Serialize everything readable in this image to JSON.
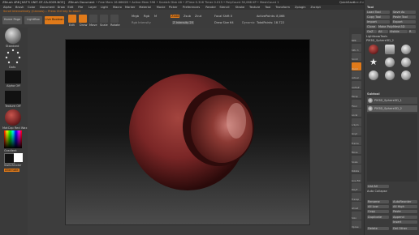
{
  "titlebar": {
    "app": "ZBrush 4R8 [HAT'S UNIT-OF-CA-0009-NO3]",
    "doc": "ZBrush Document",
    "mem": "• Free Mem 16.666GB • Active Mem 596 • Scratch Disk 48 • ZTime 0.316 Timer 0.013 • PolyCount 30,066 KP • MeshCount 1",
    "quicksave": "QuickSave",
    "seethrough": "See-through 0",
    "menus_label": "Menus",
    "default_zscript": "DefaultZScript"
  },
  "menubar": [
    "Alpha",
    "Brush",
    "Color",
    "Document",
    "Draw",
    "Edit",
    "File",
    "Layer",
    "Light",
    "Macro",
    "Marker",
    "Material",
    "Movie",
    "Picker",
    "Preferences",
    "Render",
    "Stencil",
    "Stroke",
    "Texture",
    "Tool",
    "Transform",
    "Zplugin",
    "Zscript"
  ],
  "hint": "Scroll interactively (Canvas)... Press Ctrl key to abort",
  "topshelf": {
    "home": "Home Page",
    "lightbox": "LightBox",
    "live_boolean": "Live Boolean",
    "edit": "Edit",
    "draw": "Draw",
    "move": "Move",
    "scale": "Scale",
    "rotate": "Rotate",
    "mrgb": "Mrgb",
    "rgb": "Rgb",
    "m": "M",
    "zadd": "Zadd",
    "zsub": "Zsub",
    "zcut": "Zcut",
    "zintensity": "Z Intensity 25",
    "focal_shift": "Focal Shift 0",
    "draw_size": "Draw Size 64",
    "dynamic": "Dynamic",
    "active_points": "ActivePoints: 8,066",
    "total_points": "TotalPoints: 18.722",
    "rgb_intensity": "Rgb Intensity"
  },
  "leftshelf": {
    "brush": "Standard",
    "stroke": "Dots",
    "alpha": "Alpha Off",
    "texture": "Texture Off",
    "material": "MatCap Red Wax",
    "gradient": "Gradient",
    "switch": "SwitchColor",
    "alternate": "Alternate"
  },
  "rightbar": [
    "BPR",
    "SPix 3",
    "Scroll",
    "Zoom",
    "Actual",
    "AAHalf",
    "Persp",
    "Floor",
    "Local",
    "L.Sym",
    "Gxyz",
    "Frame",
    "Move",
    "Scale",
    "Rotate",
    "Line Fill",
    "PolyF",
    "Transp",
    "Ghost",
    "Solo",
    "Xpose"
  ],
  "tool": {
    "header": "Tool",
    "load_tool": "Load Tool",
    "save_as": "Save As",
    "copy_tool": "Copy Tool",
    "paste_tool": "Paste Tool",
    "import": "Import",
    "export": "Export",
    "clone": "Clone",
    "make_polymesh": "Make PolyMesh3D",
    "goz": "GoZ",
    "all": "All",
    "visible": "Visible",
    "r": "R",
    "lightbox_tools": "Lightbox▸Tools",
    "current_tool": "PM3D_Sphere3D_2",
    "thumbs": [
      "PM3D_Sphere3D",
      "Cylinder3D",
      "SimpleBrush",
      "PolyMesh3D",
      "Sphere3D",
      "PM3D_Sphere3D_2",
      "Sphere3D_1",
      "Ultimate_PM3D_1",
      "PM3D_Sphere3D_2"
    ],
    "subtool_header": "Subtool",
    "subtools": [
      "PM3D_Sphere3D_1",
      "PM3D_Sphere3D_2"
    ],
    "list_all": "List All",
    "auto_collapse": "Auto Collapse",
    "rename": "Rename",
    "auto_reorder": "AutoReorder",
    "all_low": "All Low",
    "all_high": "All High",
    "copy": "Copy",
    "paste": "Paste",
    "duplicate": "Duplicate",
    "append": "Append",
    "insert": "Insert",
    "delete": "Delete",
    "del_other": "Del Other"
  },
  "colors": {
    "accent": "#e07a1a",
    "sphere": "#7a2626",
    "bg": "#3a3a3a"
  }
}
